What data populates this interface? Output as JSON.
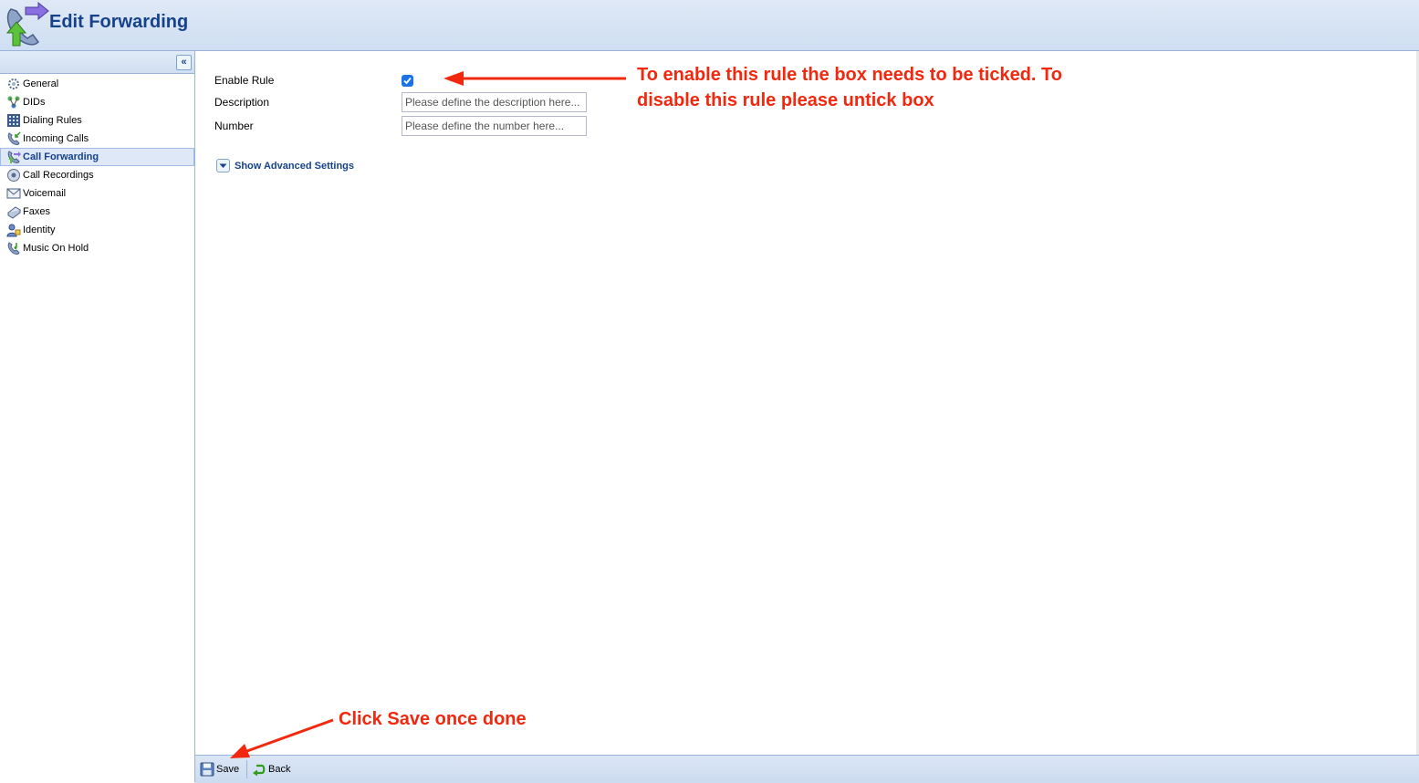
{
  "header": {
    "title": "Edit Forwarding",
    "icon": "phone-forward-icon"
  },
  "sidebar": {
    "collapse_icon": "double-chevron-left-icon",
    "items": [
      {
        "label": "General",
        "icon": "gear-icon",
        "active": false
      },
      {
        "label": "DIDs",
        "icon": "network-icon",
        "active": false
      },
      {
        "label": "Dialing Rules",
        "icon": "dialpad-icon",
        "active": false
      },
      {
        "label": "Incoming Calls",
        "icon": "incoming-call-icon",
        "active": false
      },
      {
        "label": "Call Forwarding",
        "icon": "call-forward-icon",
        "active": true
      },
      {
        "label": "Call Recordings",
        "icon": "recording-icon",
        "active": false
      },
      {
        "label": "Voicemail",
        "icon": "voicemail-icon",
        "active": false
      },
      {
        "label": "Faxes",
        "icon": "fax-icon",
        "active": false
      },
      {
        "label": "Identity",
        "icon": "user-icon",
        "active": false
      },
      {
        "label": "Music On Hold",
        "icon": "music-icon",
        "active": false
      }
    ]
  },
  "form": {
    "enable_rule_label": "Enable Rule",
    "enable_rule_checked": true,
    "description_label": "Description",
    "description_placeholder": "Please define the description here...",
    "description_value": "",
    "number_label": "Number",
    "number_placeholder": "Please define the number here...",
    "number_value": "",
    "advanced_label": "Show Advanced Settings"
  },
  "toolbar": {
    "save_label": "Save",
    "back_label": "Back"
  },
  "annotations": {
    "enable_note_line1": "To enable this rule the box needs to be ticked. To",
    "enable_note_line2": "disable this rule please untick box",
    "save_note": "Click Save once done"
  },
  "colors": {
    "brand": "#15428b",
    "annotation": "#f2280e",
    "checkbox": "#1a73e8"
  }
}
